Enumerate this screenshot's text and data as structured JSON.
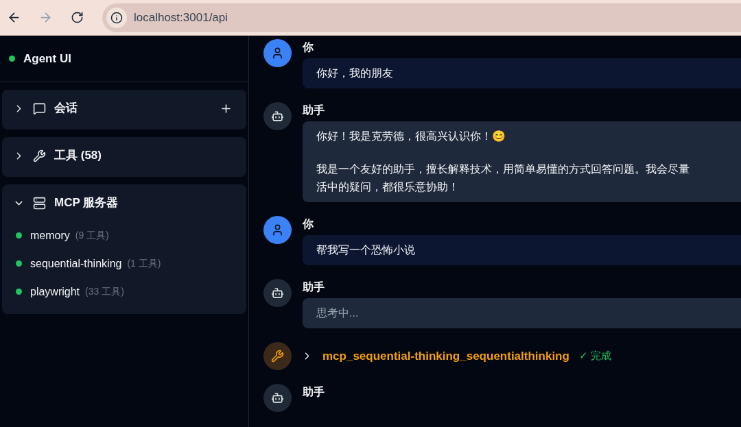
{
  "browser": {
    "back_disabled": false,
    "forward_disabled": true,
    "url": "localhost:3001/api"
  },
  "sidebar": {
    "title": "Agent UI",
    "sections": [
      {
        "kind": "chats",
        "label": "会话",
        "expanded": false,
        "has_add": true
      },
      {
        "kind": "tools",
        "label": "工具 (58)",
        "expanded": false,
        "has_add": false
      },
      {
        "kind": "servers",
        "label": "MCP 服务器",
        "expanded": true,
        "has_add": false,
        "children": [
          {
            "name": "memory",
            "count": "(9 工具)",
            "color": "#22c55e"
          },
          {
            "name": "sequential-thinking",
            "count": "(1 工具)",
            "color": "#22c55e"
          },
          {
            "name": "playwright",
            "count": "(33 工具)",
            "color": "#22c55e"
          }
        ]
      }
    ]
  },
  "messages": [
    {
      "kind": "user",
      "author": "你",
      "paragraphs": [
        [
          "你好，我的朋友"
        ]
      ]
    },
    {
      "kind": "assistant",
      "author": "助手",
      "paragraphs": [
        [
          "你好！我是克劳德，很高兴认识你！😊"
        ],
        [
          "我是一个友好的助手，擅长解释技术，用简单易懂的方式回答问题。我会尽量",
          "活中的疑问，都很乐意协助！"
        ]
      ]
    },
    {
      "kind": "user",
      "author": "你",
      "paragraphs": [
        [
          "帮我写一个恐怖小说"
        ]
      ]
    },
    {
      "kind": "thinking",
      "author": "助手",
      "paragraphs": [
        [
          "思考中..."
        ]
      ]
    },
    {
      "kind": "tool",
      "name": "mcp_sequential-thinking_sequentialthinking",
      "status": "✓ 完成",
      "expanded": false
    },
    {
      "kind": "assistant",
      "author": "助手"
    }
  ]
}
